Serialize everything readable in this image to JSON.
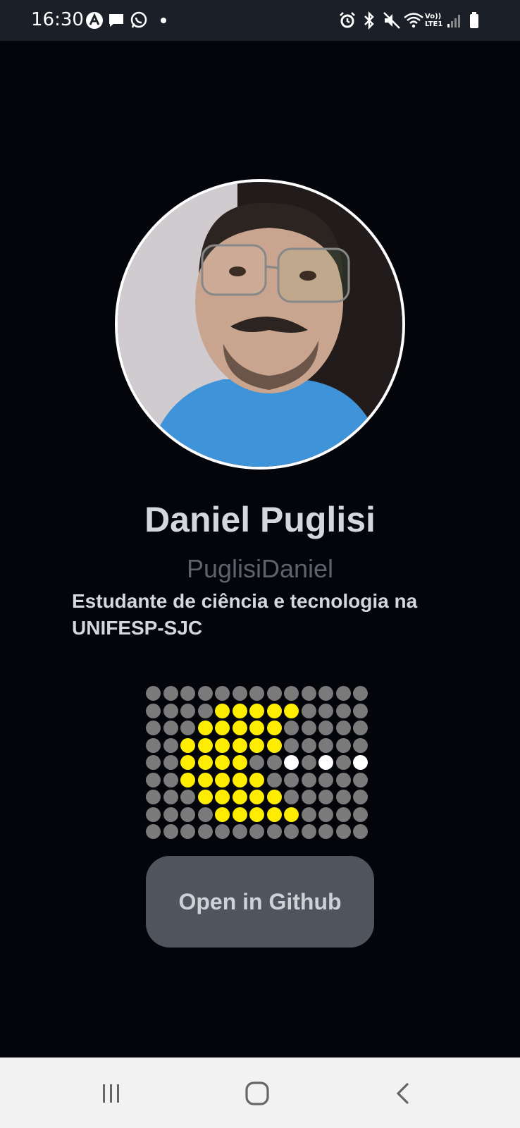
{
  "status_bar": {
    "time": "16:30",
    "left_icons": [
      "android-icon",
      "message-icon",
      "whatsapp-icon",
      "dot-icon"
    ],
    "right_icons": [
      "alarm-icon",
      "bluetooth-icon",
      "mute-icon",
      "wifi-icon",
      "volte-icon",
      "signal-icon",
      "battery-icon"
    ],
    "volte_top": "Vo))",
    "volte_bottom": "LTE1"
  },
  "profile": {
    "name": "Daniel Puglisi",
    "username": "PuglisiDaniel",
    "bio": "Estudante de ciência e tecnologia na UNIFESP-SJC"
  },
  "contribution_grid": {
    "rows": 9,
    "cols": 13,
    "cells": [
      "-------------",
      "----YYYYY----",
      "---YYYYY-----",
      "--YYYYYY-----",
      "--YYYY--W-W-W",
      "--YYYYY------",
      "---YYYYY-----",
      "----YYYYY----",
      "-------------"
    ],
    "colors": {
      "empty": "#7a7a7a",
      "yellow": "#ffed00",
      "white": "#ffffff"
    }
  },
  "github_button": {
    "label": "Open in Github"
  },
  "nav_bar": {
    "recent": "recent-apps-icon",
    "home": "home-icon",
    "back": "back-icon"
  }
}
